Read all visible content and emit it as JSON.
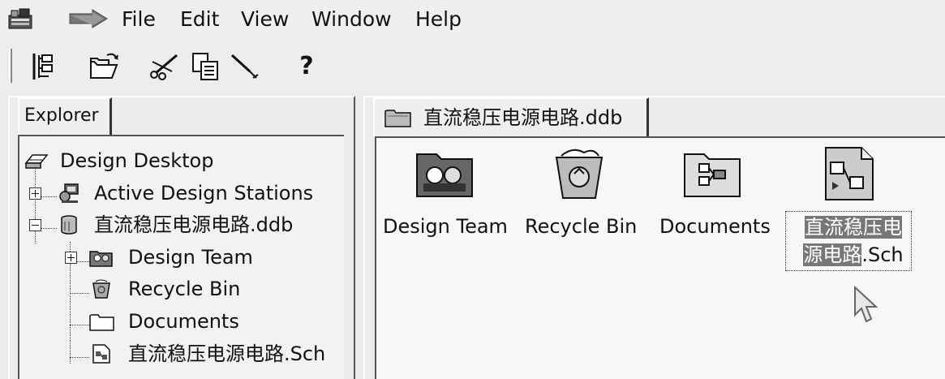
{
  "menubar": {
    "items": [
      "File",
      "Edit",
      "View",
      "Window",
      "Help"
    ],
    "icons": [
      "app-icon",
      "arrow-icon"
    ]
  },
  "toolbar": {
    "buttons": [
      "explorer-toggle-icon",
      "open-folder-icon",
      "cut-icon",
      "copy-icon",
      "paste-icon",
      "help-icon"
    ],
    "help_label": "?"
  },
  "explorer": {
    "tab_label": "Explorer",
    "tree": [
      {
        "label": "Design Desktop",
        "icon": "desktop-icon"
      },
      {
        "label": "Active Design Stations",
        "icon": "stations-icon",
        "expander": "+"
      },
      {
        "label": "直流稳压电源电路.ddb",
        "icon": "database-icon",
        "expander": "-"
      },
      {
        "label": "Design Team",
        "icon": "team-icon",
        "expander": "+"
      },
      {
        "label": "Recycle Bin",
        "icon": "recycle-bin-icon"
      },
      {
        "label": "Documents",
        "icon": "folder-icon"
      },
      {
        "label": "直流稳压电源电路.Sch",
        "icon": "schematic-icon"
      }
    ]
  },
  "document": {
    "tab_label": "直流稳压电源电路.ddb",
    "items": [
      {
        "caption": "Design Team",
        "icon": "team-icon"
      },
      {
        "caption": "Recycle Bin",
        "icon": "recycle-bin-icon"
      },
      {
        "caption": "Documents",
        "icon": "documents-icon"
      },
      {
        "caption_line1": "直流稳压电",
        "caption_line2_highlight": "源电路",
        "caption_line2_rest": ".Sch",
        "icon": "schematic-icon"
      }
    ]
  }
}
